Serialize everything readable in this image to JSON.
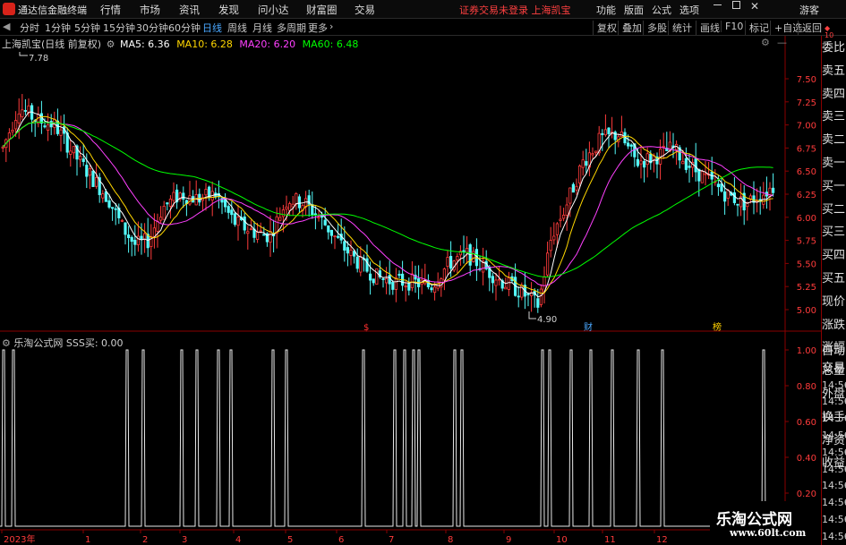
{
  "app": {
    "title": "通达信金融终端"
  },
  "menu": [
    "行情",
    "市场",
    "资讯",
    "发现",
    "问小达",
    "财富圈",
    "交易"
  ],
  "status_text": "证券交易未登录  上海凯宝",
  "right_menu": [
    "功能",
    "版面",
    "公式",
    "选项",
    "游客"
  ],
  "window_controls": [
    "minimize-icon",
    "restore-icon",
    "close-icon"
  ],
  "periods": [
    "分时",
    "1分钟",
    "5分钟",
    "15分钟",
    "30分钟",
    "60分钟",
    "日线",
    "周线",
    "月线",
    "多周期",
    "更多"
  ],
  "active_period": "日线",
  "right_tools": [
    "复权",
    "叠加",
    "多股",
    "统计",
    "画线",
    "F10",
    "标记",
    "+自选",
    "返回"
  ],
  "stock_label": "上海凯宝(日线 前复权)",
  "ma": [
    {
      "label": "MA5: 6.36",
      "color": "#ffffff"
    },
    {
      "label": "MA10: 6.28",
      "color": "#ffd700"
    },
    {
      "label": "MA20: 6.20",
      "color": "#ff40ff"
    },
    {
      "label": "MA60: 6.48",
      "color": "#00ff00"
    }
  ],
  "price_axis": [
    "7.50",
    "7.25",
    "7.00",
    "6.75",
    "6.50",
    "6.25",
    "6.00",
    "5.75",
    "5.50",
    "5.25",
    "5.00"
  ],
  "high_label": "7.78",
  "low_label": "4.90",
  "event_marks": [
    {
      "text": "$",
      "color": "#ff3030"
    },
    {
      "text": "财",
      "color": "#4aa8ff"
    },
    {
      "text": "榜",
      "color": "#ffd000"
    }
  ],
  "sub_indicator": "乐淘公式网 SSS买: 0.00",
  "sub_axis": [
    "1.00",
    "0.80",
    "0.60",
    "0.40",
    "0.20"
  ],
  "x_axis": [
    "2023年",
    "1",
    "2",
    "3",
    "4",
    "5",
    "6",
    "7",
    "8",
    "9",
    "10",
    "11",
    "12"
  ],
  "sidebar_top": [
    "委比",
    "卖五",
    "卖四",
    "卖三",
    "卖二",
    "卖一",
    "买一",
    "买二",
    "买三",
    "买四",
    "买五",
    "现价",
    "涨跌",
    "涨幅",
    "总量",
    "外盘",
    "换手",
    "净资",
    "收益"
  ],
  "sidebar_bottom": [
    "自动",
    "交易",
    "14:56",
    "14:56",
    "14:56",
    "14:56",
    "14:56",
    "14:56",
    "14:56",
    "14:56",
    "14:56",
    "14:56"
  ],
  "mini_num": "10",
  "watermark": {
    "line1": "乐淘公式网",
    "line2": "www.60lt.com"
  }
}
